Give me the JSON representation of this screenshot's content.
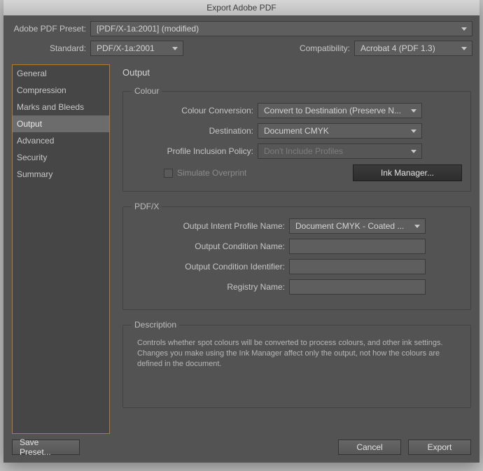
{
  "titlebar": "Export Adobe PDF",
  "presetRow": {
    "label": "Adobe PDF Preset:",
    "value": "[PDF/X-1a:2001] (modified)"
  },
  "standardRow": {
    "label": "Standard:",
    "value": "PDF/X-1a:2001"
  },
  "compatRow": {
    "label": "Compatibility:",
    "value": "Acrobat 4 (PDF 1.3)"
  },
  "sidebar": {
    "items": [
      {
        "label": "General"
      },
      {
        "label": "Compression"
      },
      {
        "label": "Marks and Bleeds"
      },
      {
        "label": "Output"
      },
      {
        "label": "Advanced"
      },
      {
        "label": "Security"
      },
      {
        "label": "Summary"
      }
    ],
    "selectedIndex": 3
  },
  "panelTitle": "Output",
  "colour": {
    "legend": "Colour",
    "conversion": {
      "label": "Colour Conversion:",
      "value": "Convert to Destination (Preserve N..."
    },
    "destination": {
      "label": "Destination:",
      "value": "Document CMYK"
    },
    "profilePolicy": {
      "label": "Profile Inclusion Policy:",
      "value": "Don't Include Profiles"
    },
    "simulateOverprint": "Simulate Overprint",
    "inkManager": "Ink Manager..."
  },
  "pdfx": {
    "legend": "PDF/X",
    "outputIntent": {
      "label": "Output Intent Profile Name:",
      "value": "Document CMYK - Coated ..."
    },
    "conditionName": {
      "label": "Output Condition Name:",
      "value": ""
    },
    "conditionId": {
      "label": "Output Condition Identifier:",
      "value": ""
    },
    "registry": {
      "label": "Registry Name:",
      "value": ""
    }
  },
  "description": {
    "legend": "Description",
    "text": "Controls whether spot colours will be converted to process colours, and other ink settings. Changes you make using the Ink Manager affect only the output, not how the colours are defined in the document."
  },
  "footer": {
    "savePreset": "Save Preset...",
    "cancel": "Cancel",
    "export": "Export"
  }
}
